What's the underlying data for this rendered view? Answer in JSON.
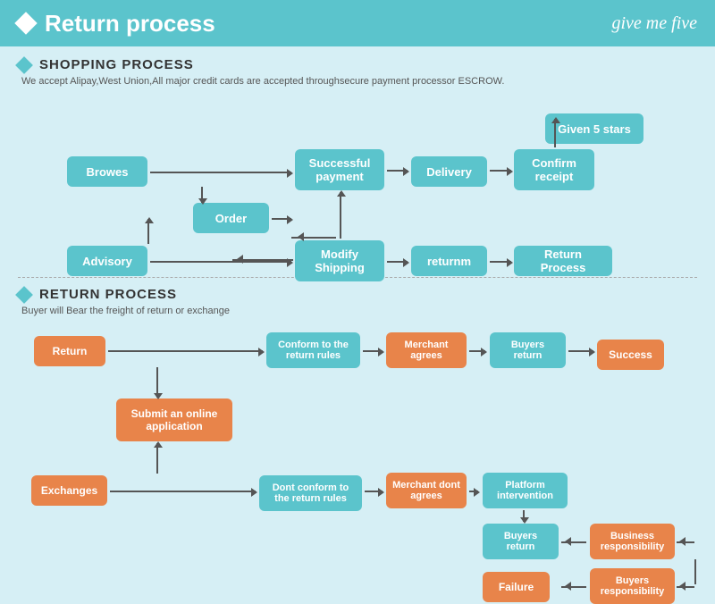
{
  "header": {
    "title": "Return process",
    "logo": "give me five",
    "diamond_color": "#fff"
  },
  "shopping": {
    "section_title": "SHOPPING PROCESS",
    "desc": "We accept Alipay,West Union,All major credit cards are accepted throughsecure payment processor ESCROW.",
    "boxes": {
      "browes": "Browes",
      "order": "Order",
      "advisory": "Advisory",
      "modify_shipping": "Modify\nShipping",
      "successful_payment": "Successful\npayment",
      "delivery": "Delivery",
      "confirm_receipt": "Confirm\nreceipt",
      "given_5_stars": "Given 5 stars",
      "returnrm": "returnm",
      "return_process": "Return Process"
    }
  },
  "return": {
    "section_title": "RETURN PROCESS",
    "desc": "Buyer will Bear the freight of return or exchange",
    "boxes": {
      "return": "Return",
      "exchanges": "Exchanges",
      "submit_online": "Submit an online\napplication",
      "conform_return": "Conform to the\nreturn rules",
      "dont_conform": "Dont conform to the\nreturn rules",
      "merchant_agrees": "Merchant\nagrees",
      "merchant_dont": "Merchant\ndont agrees",
      "buyers_return1": "Buyers\nreturn",
      "buyers_return2": "Buyers\nreturn",
      "platform_intervention": "Platform\nintervention",
      "success": "Success",
      "business_responsibility": "Business\nresponsibility",
      "buyers_responsibility": "Buyers\nresponsibility",
      "failure": "Failure"
    }
  }
}
